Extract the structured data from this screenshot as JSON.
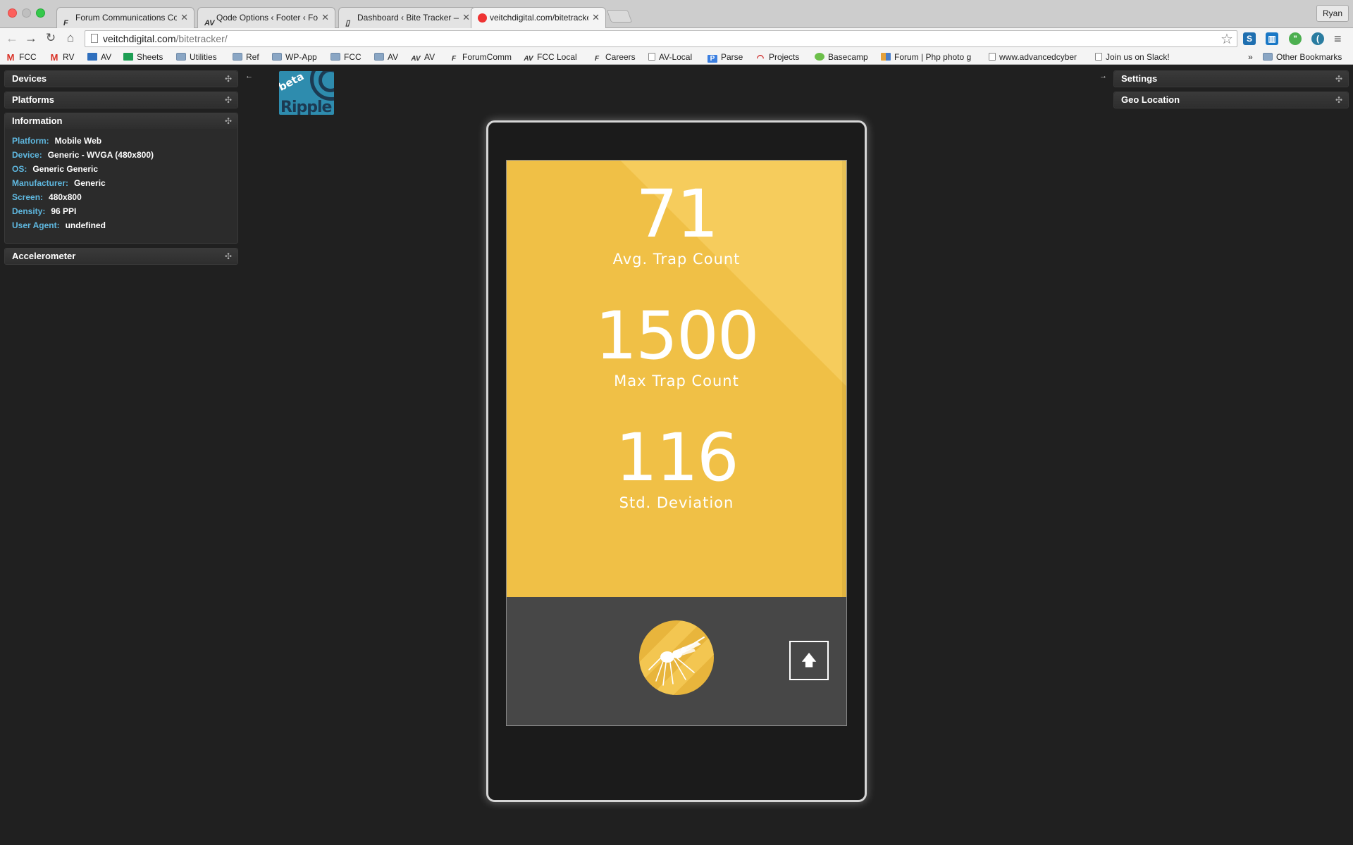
{
  "browser": {
    "tabs": [
      {
        "title": "Forum Communications Co",
        "favicon": "fc-icon",
        "active": false
      },
      {
        "title": "Qode Options ‹ Footer ‹ For",
        "favicon": "av-icon",
        "active": false
      },
      {
        "title": "Dashboard ‹ Bite Tracker —",
        "favicon": "page-icon",
        "active": false
      },
      {
        "title": "veitchdigital.com/bitetracker",
        "favicon": "ripple-icon",
        "active": true
      }
    ],
    "tab_close_glyph": "✕",
    "user_name": "Ryan",
    "url_host": "veitchdigital.com",
    "url_path": "/bitetracker/",
    "bookmarks": [
      {
        "label": "FCC",
        "icon": "gmail-icon"
      },
      {
        "label": "RV",
        "icon": "gmail-icon"
      },
      {
        "label": "AV",
        "icon": "trello-icon"
      },
      {
        "label": "Sheets",
        "icon": "sheets-icon"
      },
      {
        "label": "Utilities",
        "icon": "folder-icon"
      },
      {
        "label": "Ref",
        "icon": "folder-icon"
      },
      {
        "label": "WP-App",
        "icon": "folder-icon"
      },
      {
        "label": "FCC",
        "icon": "folder-icon"
      },
      {
        "label": "AV",
        "icon": "folder-icon"
      },
      {
        "label": "AV",
        "icon": "av-icon"
      },
      {
        "label": "ForumComm",
        "icon": "fc-icon"
      },
      {
        "label": "FCC Local",
        "icon": "av-icon"
      },
      {
        "label": "Careers",
        "icon": "fc-icon"
      },
      {
        "label": "AV-Local",
        "icon": "page-icon"
      },
      {
        "label": "Parse",
        "icon": "parse-icon"
      },
      {
        "label": "Projects",
        "icon": "projects-icon"
      },
      {
        "label": "Basecamp",
        "icon": "basecamp-icon"
      },
      {
        "label": "Forum | Php photo g",
        "icon": "photo-icon"
      },
      {
        "label": "www.advancedcyber",
        "icon": "page-icon"
      },
      {
        "label": "Join us on Slack!",
        "icon": "page-icon"
      }
    ],
    "bookmarks_overflow": "»",
    "other_bookmarks": "Other Bookmarks"
  },
  "ripple": {
    "left_panels": {
      "devices": "Devices",
      "platforms": "Platforms",
      "information": "Information",
      "accelerometer": "Accelerometer"
    },
    "right_panels": {
      "settings": "Settings",
      "geo_location": "Geo Location"
    },
    "information": [
      {
        "label": "Platform:",
        "value": "Mobile Web"
      },
      {
        "label": "Device:",
        "value": "Generic - WVGA (480x800)"
      },
      {
        "label": "OS:",
        "value": "Generic Generic"
      },
      {
        "label": "Manufacturer:",
        "value": "Generic"
      },
      {
        "label": "Screen:",
        "value": "480x800"
      },
      {
        "label": "Density:",
        "value": "96 PPI"
      },
      {
        "label": "User Agent:",
        "value": "undefined"
      }
    ],
    "logo_beta": "beta",
    "logo_brand": "Ripple",
    "collapse_left_glyph": "←",
    "collapse_right_glyph": "→",
    "pin_glyph": "✣"
  },
  "app": {
    "stats": [
      {
        "value": "71",
        "label": "Avg. Trap Count"
      },
      {
        "value": "1500",
        "label": "Max Trap Count"
      },
      {
        "value": "116",
        "label": "Std. Deviation"
      }
    ],
    "up_glyph": "🡅",
    "colors": {
      "accent": "#f0c046",
      "accent_light": "#f6cc5c",
      "bottom_bar": "#474747",
      "page_bg": "#202020"
    }
  }
}
